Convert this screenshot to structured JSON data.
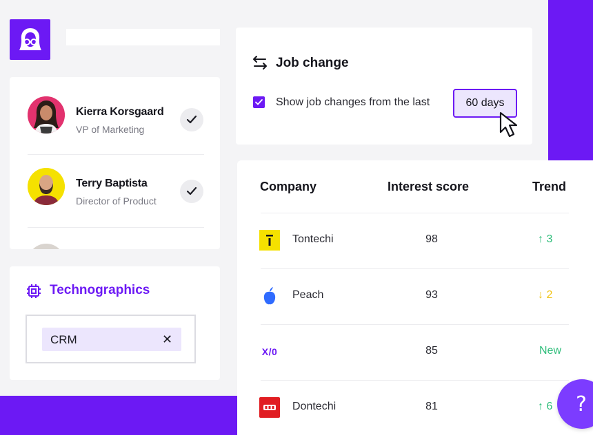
{
  "colors": {
    "brand": "#6c19f4",
    "trend_up": "#2ebd7a",
    "trend_down": "#f0c419",
    "tag_bg": "#ece6fd"
  },
  "logo": {
    "icon": "girl-with-glasses-logo-icon"
  },
  "contacts": [
    {
      "name": "Kierra Korsgaard",
      "title": "VP of Marketing",
      "checked": true
    },
    {
      "name": "Terry Baptista",
      "title": "Director of Product",
      "checked": true
    }
  ],
  "technographics": {
    "title": "Technographics",
    "icon": "chip-icon",
    "tags": [
      {
        "label": "CRM",
        "remove_icon": "close-icon"
      }
    ]
  },
  "job_change": {
    "title": "Job change",
    "icon": "swap-arrows-icon",
    "checkbox_checked": true,
    "checkbox_label": "Show job changes from the last",
    "days_value": "60 days"
  },
  "table": {
    "headers": {
      "company": "Company",
      "score": "Interest score",
      "trend": "Trend"
    },
    "rows": [
      {
        "company": "Tontechi",
        "score": "98",
        "trend": "↑ 3",
        "trend_type": "up",
        "logo": "tontechi-logo-icon"
      },
      {
        "company": "Peach",
        "score": "93",
        "trend": "↓ 2",
        "trend_type": "down",
        "logo": "peach-logo-icon"
      },
      {
        "company": "",
        "logo_text": "X/0",
        "score": "85",
        "trend": "New",
        "trend_type": "new",
        "logo": "x0-logo-icon"
      },
      {
        "company": "Dontechi",
        "score": "81",
        "trend": "↑ 6",
        "trend_type": "up",
        "logo": "dontechi-logo-icon"
      }
    ]
  },
  "help": {
    "label": "?"
  }
}
